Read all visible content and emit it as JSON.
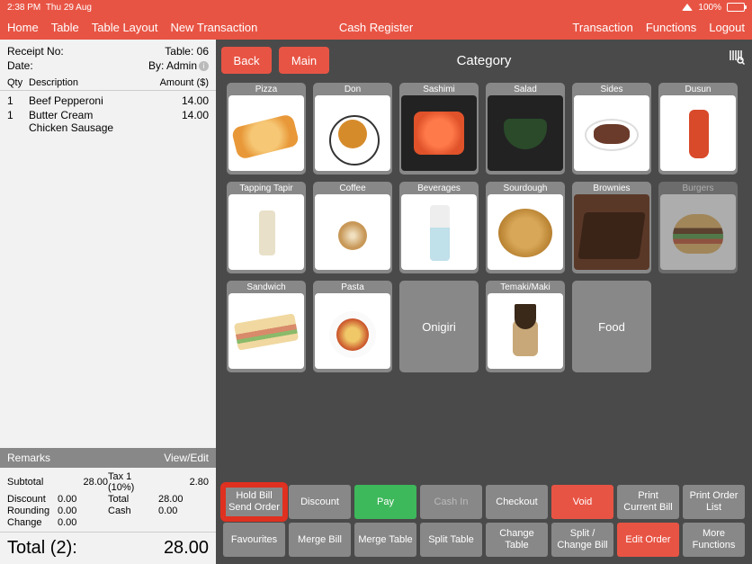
{
  "status": {
    "time": "2:38 PM",
    "date": "Thu 29 Aug",
    "battery": "100%"
  },
  "nav": {
    "home": "Home",
    "table": "Table",
    "layout": "Table Layout",
    "newtx": "New Transaction",
    "title": "Cash Register",
    "transaction": "Transaction",
    "functions": "Functions",
    "logout": "Logout"
  },
  "receipt": {
    "no_label": "Receipt No:",
    "no_value": "",
    "table_label": "Table:",
    "table_value": "06",
    "date_label": "Date:",
    "date_value": "",
    "by_label": "By:",
    "by_value": "Admin",
    "col_qty": "Qty",
    "col_desc": "Description",
    "col_amt": "Amount ($)",
    "items": [
      {
        "qty": "1",
        "desc": "Beef Pepperoni",
        "desc2": "",
        "amt": "14.00"
      },
      {
        "qty": "1",
        "desc": "Butter Cream",
        "desc2": "Chicken Sausage",
        "amt": "14.00"
      }
    ],
    "remarks": "Remarks",
    "viewedit": "View/Edit",
    "subtotal_l": "Subtotal",
    "subtotal_v": "28.00",
    "tax_l": "Tax 1 (10%)",
    "tax_v": "2.80",
    "discount_l": "Discount",
    "discount_v": "0.00",
    "total_l": "Total",
    "total_v": "28.00",
    "rounding_l": "Rounding",
    "rounding_v": "0.00",
    "cash_l": "Cash",
    "cash_v": "0.00",
    "change_l": "Change",
    "change_v": "0.00",
    "grand_l": "Total (2):",
    "grand_v": "28.00"
  },
  "top": {
    "back": "Back",
    "main": "Main",
    "category": "Category"
  },
  "cats": [
    {
      "label": "Pizza",
      "img": "pizza"
    },
    {
      "label": "Don",
      "img": "don"
    },
    {
      "label": "Sashimi",
      "img": "sashimi"
    },
    {
      "label": "Salad",
      "img": "salad"
    },
    {
      "label": "Sides",
      "img": "sides"
    },
    {
      "label": "Dusun",
      "img": "dusun"
    },
    {
      "label": "Tapping Tapir",
      "img": "tapping"
    },
    {
      "label": "Coffee",
      "img": "coffee"
    },
    {
      "label": "Beverages",
      "img": "beverage"
    },
    {
      "label": "Sourdough",
      "img": "sourdough"
    },
    {
      "label": "Brownies",
      "img": "brownies"
    },
    {
      "label": "Burgers",
      "img": "burger",
      "dim": true
    },
    {
      "label": "Sandwich",
      "img": "sandwich"
    },
    {
      "label": "Pasta",
      "img": "pasta"
    },
    {
      "label": "Onigiri",
      "text": true
    },
    {
      "label": "Temaki/Maki",
      "img": "temaki"
    },
    {
      "label": "Food",
      "text": true
    }
  ],
  "actions_row1": [
    {
      "label": "Hold Bill Send Order",
      "cls": "highlight"
    },
    {
      "label": "Discount"
    },
    {
      "label": "Pay",
      "cls": "green"
    },
    {
      "label": "Cash In",
      "cls": "dim2"
    },
    {
      "label": "Checkout"
    },
    {
      "label": "Void",
      "cls": "red"
    },
    {
      "label": "Print Current Bill"
    },
    {
      "label": "Print Order List"
    }
  ],
  "actions_row2": [
    {
      "label": "Favourites"
    },
    {
      "label": "Merge Bill"
    },
    {
      "label": "Merge Table"
    },
    {
      "label": "Split Table"
    },
    {
      "label": "Change Table"
    },
    {
      "label": "Split / Change Bill"
    },
    {
      "label": "Edit Order",
      "cls": "red"
    },
    {
      "label": "More Functions"
    }
  ]
}
